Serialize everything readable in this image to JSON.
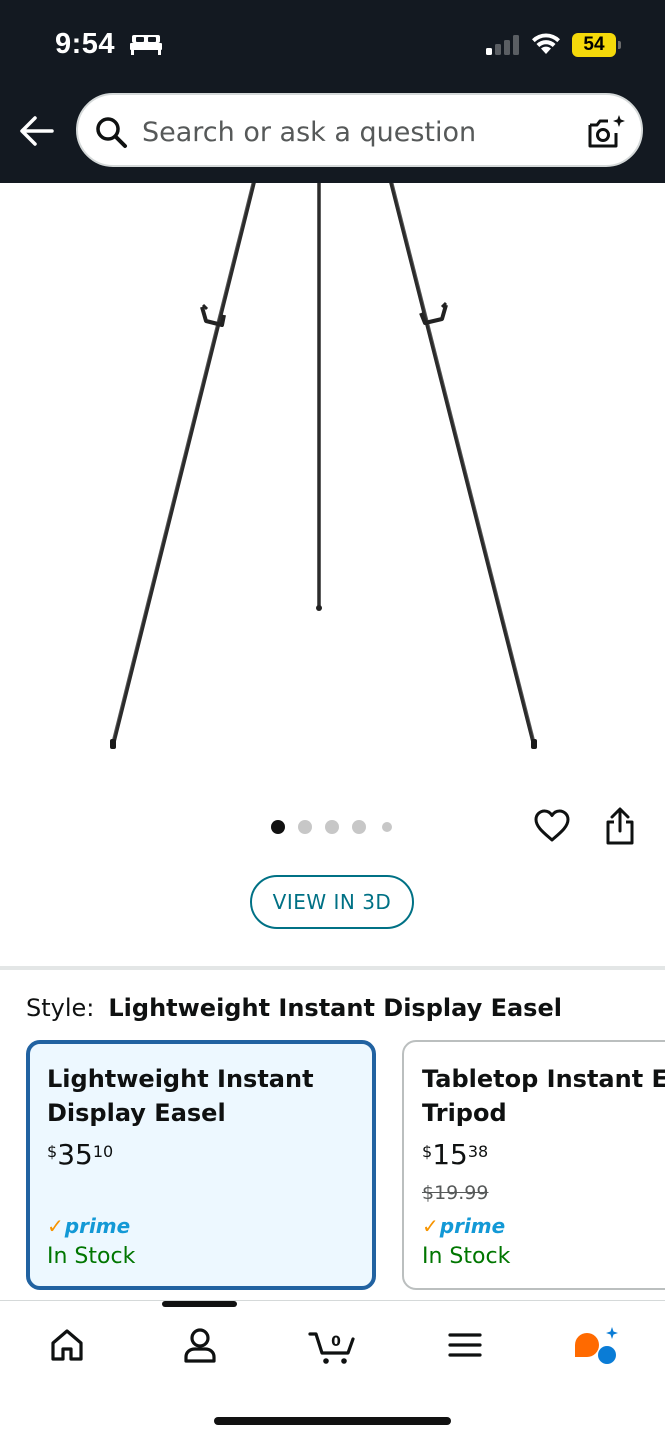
{
  "status_bar": {
    "time": "9:54",
    "battery_percent": "54",
    "icons": [
      "bed-icon",
      "cellular-signal-icon",
      "wifi-icon",
      "battery-icon"
    ]
  },
  "search": {
    "placeholder": "Search or ask a question"
  },
  "product_image": {
    "current_index": 1,
    "image_count": 5
  },
  "actions": {
    "view_3d_label": "VIEW IN 3D"
  },
  "style": {
    "label": "Style:",
    "value": "Lightweight Instant Display Easel"
  },
  "variants": [
    {
      "title_line1": "Lightweight Instant",
      "title_line2": "Display Easel",
      "price_symbol": "$",
      "price_whole": "35",
      "price_fraction": "10",
      "list_price": "",
      "prime_label": "prime",
      "stock": "In Stock",
      "selected": true
    },
    {
      "title_line1": "Tabletop Instant Ea",
      "title_line2": "Tripod",
      "price_symbol": "$",
      "price_whole": "15",
      "price_fraction": "38",
      "list_price": "$19.99",
      "prime_label": "prime",
      "stock": "In Stock",
      "selected": false
    }
  ],
  "bottom_nav": {
    "items": [
      "home-icon",
      "account-icon",
      "cart-icon",
      "menu-icon",
      "rufus-ai-icon"
    ],
    "cart_count": "0"
  },
  "colors": {
    "header_bg": "#131921",
    "link_teal": "#007185",
    "selected_border": "#2162a1",
    "in_stock_green": "#007600",
    "prime_blue": "#1399d6",
    "prime_check_orange": "#f79400"
  }
}
